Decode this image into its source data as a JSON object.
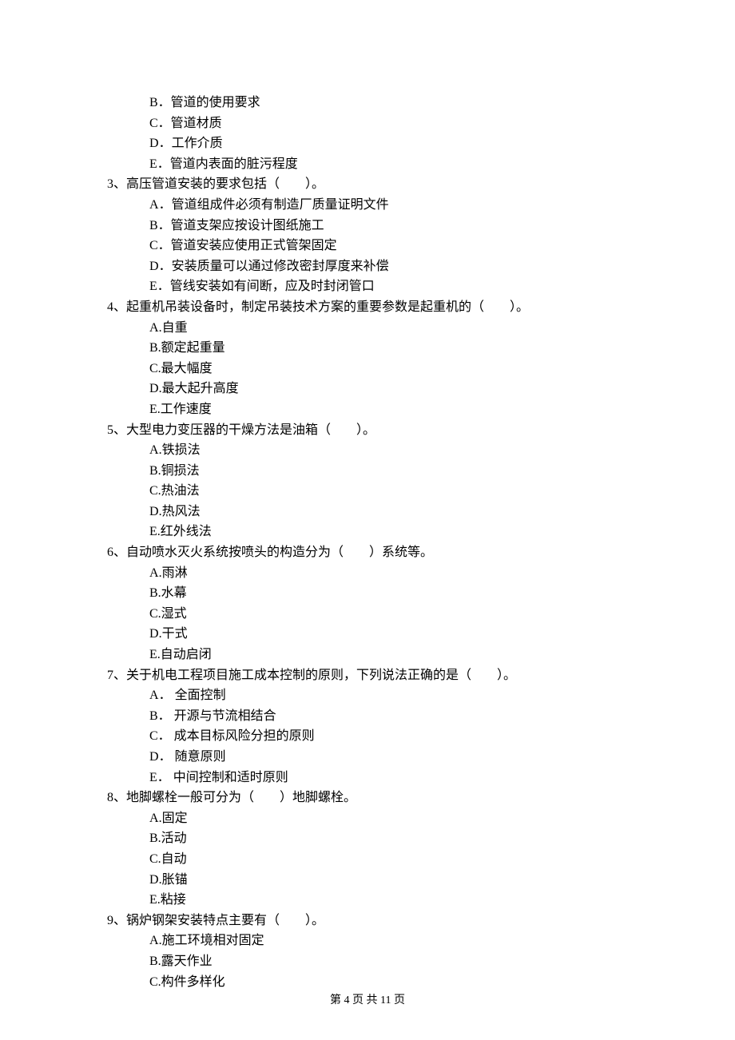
{
  "orphan_options": [
    {
      "letter": "B",
      "text": "．管道的使用要求"
    },
    {
      "letter": "C",
      "text": "．管道材质"
    },
    {
      "letter": "D",
      "text": "．工作介质"
    },
    {
      "letter": "E",
      "text": "．管道内表面的脏污程度"
    }
  ],
  "questions": [
    {
      "number": "3",
      "stem": "、高压管道安装的要求包括（　　）。",
      "options": [
        {
          "letter": "A",
          "text": "．管道组成件必须有制造厂质量证明文件"
        },
        {
          "letter": "B",
          "text": "．管道支架应按设计图纸施工"
        },
        {
          "letter": "C",
          "text": "．管道安装应使用正式管架固定"
        },
        {
          "letter": "D",
          "text": "．安装质量可以通过修改密封厚度来补偿"
        },
        {
          "letter": "E",
          "text": "．管线安装如有间断，应及时封闭管口"
        }
      ]
    },
    {
      "number": "4",
      "stem": "、起重机吊装设备时，制定吊装技术方案的重要参数是起重机的（　　）。",
      "options": [
        {
          "letter": "A",
          "text": ".自重"
        },
        {
          "letter": "B",
          "text": ".额定起重量"
        },
        {
          "letter": "C",
          "text": ".最大幅度"
        },
        {
          "letter": "D",
          "text": ".最大起升高度"
        },
        {
          "letter": "E",
          "text": ".工作速度"
        }
      ]
    },
    {
      "number": "5",
      "stem": "、大型电力变压器的干燥方法是油箱（　　）。",
      "options": [
        {
          "letter": "A",
          "text": ".铁损法"
        },
        {
          "letter": "B",
          "text": ".铜损法"
        },
        {
          "letter": "C",
          "text": ".热油法"
        },
        {
          "letter": "D",
          "text": ".热风法"
        },
        {
          "letter": "E",
          "text": ".红外线法"
        }
      ]
    },
    {
      "number": "6",
      "stem": "、自动喷水灭火系统按喷头的构造分为（　　）系统等。",
      "options": [
        {
          "letter": "A",
          "text": ".雨淋"
        },
        {
          "letter": "B",
          "text": ".水幕"
        },
        {
          "letter": "C",
          "text": ".湿式"
        },
        {
          "letter": "D",
          "text": ".干式"
        },
        {
          "letter": "E",
          "text": ".自动启闭"
        }
      ]
    },
    {
      "number": "7",
      "stem": "、关于机电工程项目施工成本控制的原则，下列说法正确的是（　　）。",
      "options": [
        {
          "letter": "A",
          "text": "． 全面控制"
        },
        {
          "letter": "B",
          "text": "． 开源与节流相结合"
        },
        {
          "letter": "C",
          "text": "． 成本目标风险分担的原则"
        },
        {
          "letter": "D",
          "text": "． 随意原则"
        },
        {
          "letter": "E",
          "text": "． 中间控制和适时原则"
        }
      ]
    },
    {
      "number": "8",
      "stem": "、地脚螺栓一般可分为（　　）地脚螺栓。",
      "options": [
        {
          "letter": "A",
          "text": ".固定"
        },
        {
          "letter": "B",
          "text": ".活动"
        },
        {
          "letter": "C",
          "text": ".自动"
        },
        {
          "letter": "D",
          "text": ".胀锚"
        },
        {
          "letter": "E",
          "text": ".粘接"
        }
      ]
    },
    {
      "number": "9",
      "stem": "、锅炉钢架安装特点主要有（　　）。",
      "options": [
        {
          "letter": "A",
          "text": ".施工环境相对固定"
        },
        {
          "letter": "B",
          "text": ".露天作业"
        },
        {
          "letter": "C",
          "text": ".构件多样化"
        }
      ]
    }
  ],
  "footer": {
    "prefix": "第 ",
    "current": "4",
    "middle": " 页 共 ",
    "total": "11",
    "suffix": " 页"
  }
}
